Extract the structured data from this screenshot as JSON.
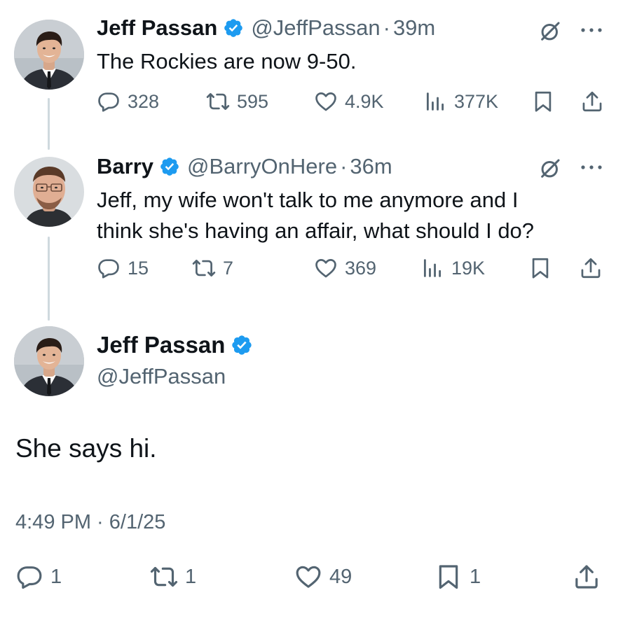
{
  "colors": {
    "text": "#0f1419",
    "muted": "#536471",
    "verified": "#1d9bf0",
    "thread": "#cfd9de"
  },
  "tweet1": {
    "name": "Jeff Passan",
    "handle": "@JeffPassan",
    "dot": "·",
    "time": "39m",
    "text": "The Rockies are now 9-50.",
    "replies": "328",
    "reposts": "595",
    "likes": "4.9K",
    "views": "377K"
  },
  "tweet2": {
    "name": "Barry",
    "handle": "@BarryOnHere",
    "dot": "·",
    "time": "36m",
    "text_line1": "Jeff, my wife won't talk to me anymore and I",
    "text_line2": "think she's having an affair, what should I do?",
    "replies": "15",
    "reposts": "7",
    "likes": "369",
    "views": "19K"
  },
  "main": {
    "name": "Jeff Passan",
    "handle": "@JeffPassan",
    "text": "She says hi.",
    "timestamp": "4:49 PM · 6/1/25",
    "replies": "1",
    "reposts": "1",
    "likes": "49",
    "bookmarks": "1"
  },
  "icons": [
    "verified-badge-icon",
    "grok-icon",
    "more-icon",
    "reply-icon",
    "repost-icon",
    "like-icon",
    "views-icon",
    "bookmark-icon",
    "share-icon"
  ]
}
